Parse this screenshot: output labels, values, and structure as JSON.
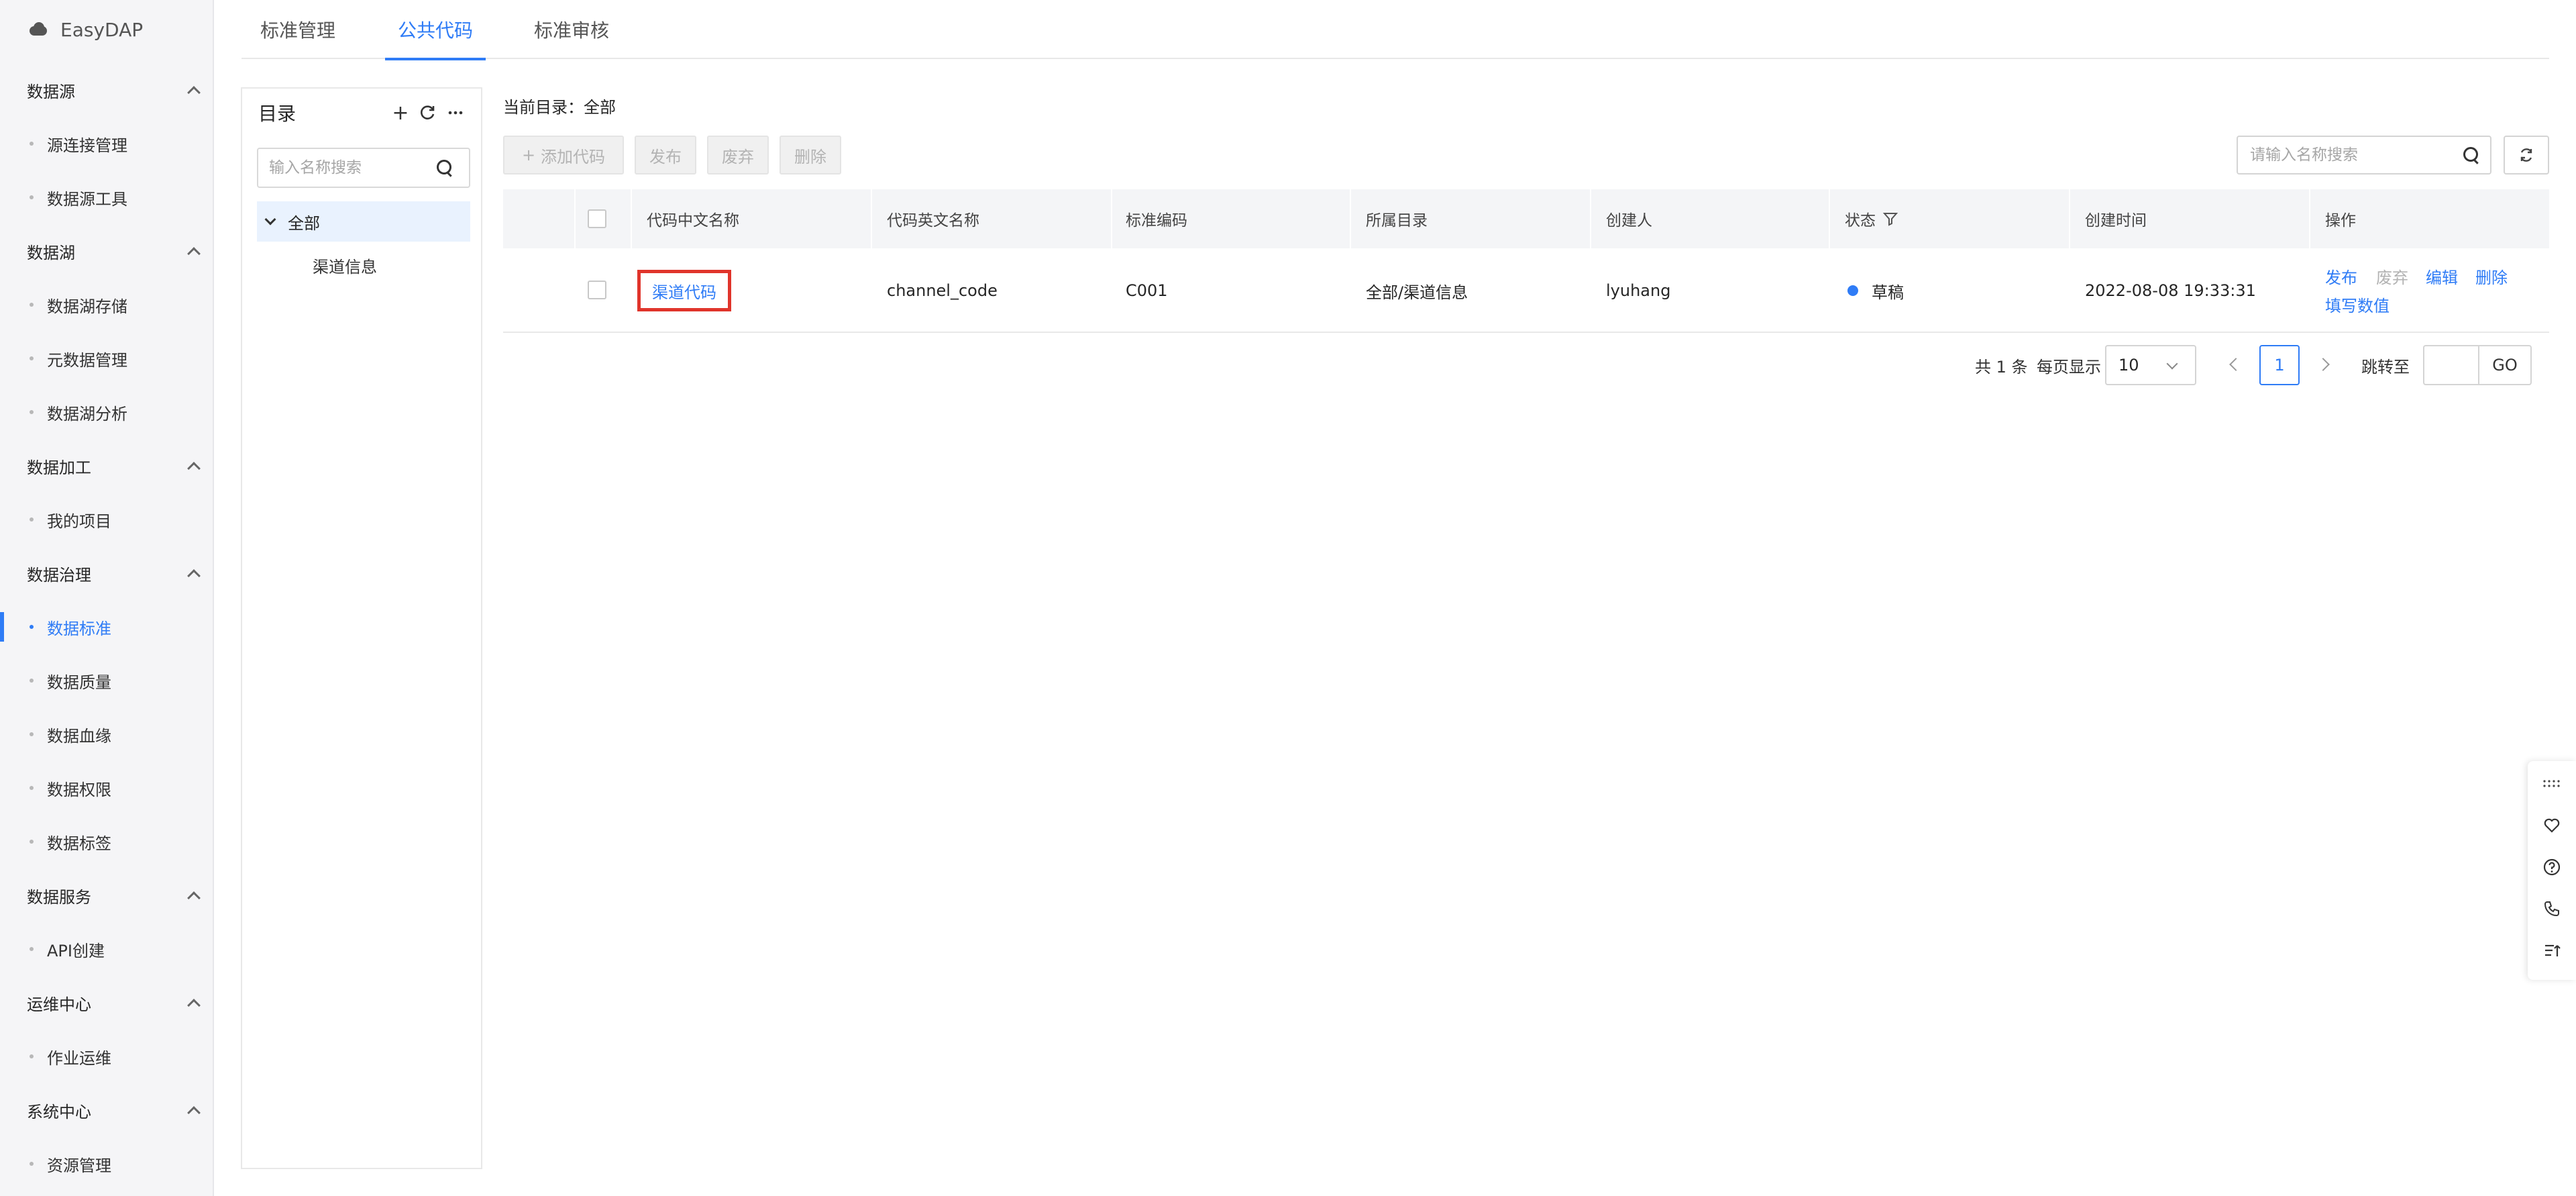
{
  "app": {
    "brand": "EasyDAP"
  },
  "sidebar": {
    "groups": [
      {
        "title": "数据源",
        "items": [
          "源连接管理",
          "数据源工具"
        ]
      },
      {
        "title": "数据湖",
        "items": [
          "数据湖存储",
          "元数据管理",
          "数据湖分析"
        ]
      },
      {
        "title": "数据加工",
        "items": [
          "我的项目"
        ]
      },
      {
        "title": "数据治理",
        "items": [
          "数据标准",
          "数据质量",
          "数据血缘",
          "数据权限",
          "数据标签"
        ]
      },
      {
        "title": "数据服务",
        "items": [
          "API创建"
        ]
      },
      {
        "title": "运维中心",
        "items": [
          "作业运维"
        ]
      },
      {
        "title": "系统中心",
        "items": [
          "资源管理"
        ]
      }
    ],
    "active_item": "数据标准"
  },
  "tabs": [
    "标准管理",
    "公共代码",
    "标准审核"
  ],
  "active_tab": "公共代码",
  "directory": {
    "title": "目录",
    "search_placeholder": "输入名称搜索",
    "tree": {
      "root": "全部",
      "children": [
        "渠道信息"
      ]
    }
  },
  "main": {
    "current_dir_label": "当前目录：",
    "current_dir_value": "全部",
    "toolbar": {
      "add": "添加代码",
      "publish": "发布",
      "discard": "废弃",
      "delete": "删除"
    },
    "search_placeholder": "请输入名称搜索"
  },
  "table": {
    "headers": [
      "代码中文名称",
      "代码英文名称",
      "标准编码",
      "所属目录",
      "创建人",
      "状态",
      "创建时间",
      "操作"
    ],
    "rows": [
      {
        "cn_name": "渠道代码",
        "en_name": "channel_code",
        "code": "C001",
        "dir": "全部/渠道信息",
        "creator": "lyuhang",
        "status": "草稿",
        "created": "2022-08-08 19:33:31",
        "ops": {
          "publish": "发布",
          "discard": "废弃",
          "edit": "编辑",
          "delete": "删除",
          "fill": "填写数值"
        }
      }
    ]
  },
  "pagination": {
    "total_text": "共 1 条",
    "page_size_label": "每页显示",
    "page_size": "10",
    "current_page": "1",
    "jump_label": "跳转至",
    "go": "GO"
  },
  "colors": {
    "accent": "#2f7cf6",
    "highlight_border": "#e0342b"
  }
}
